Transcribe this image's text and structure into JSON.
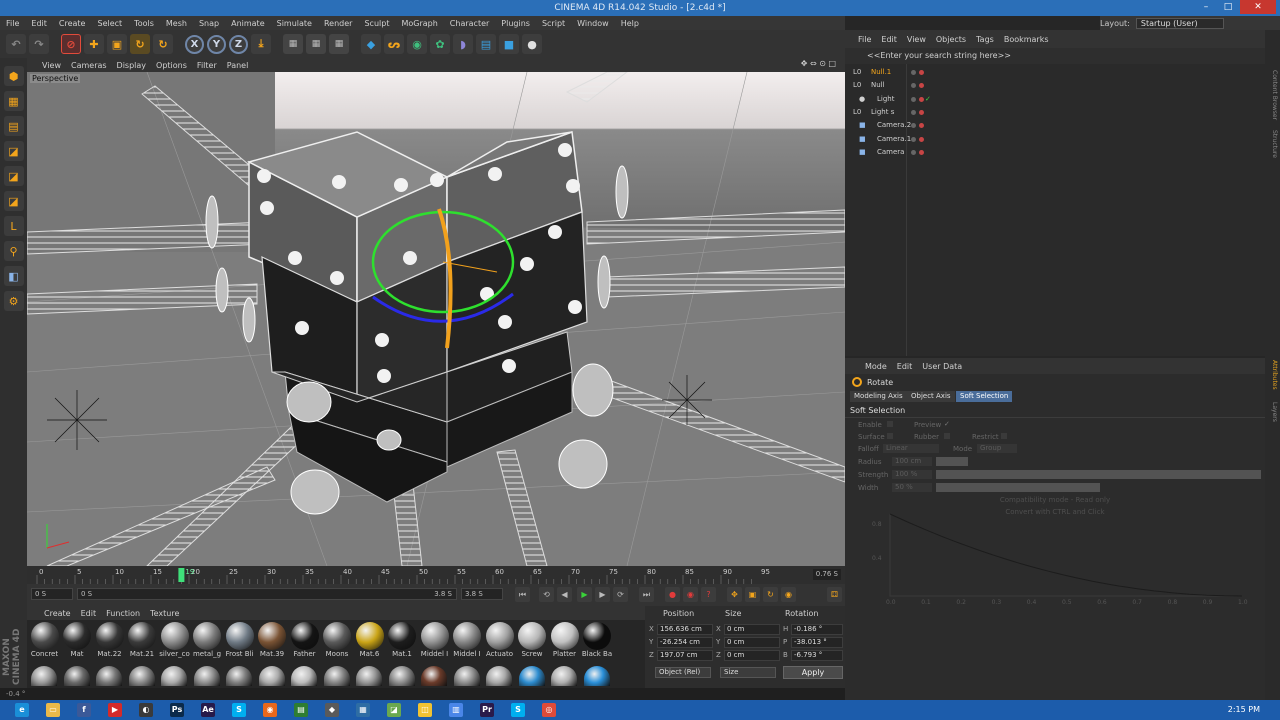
{
  "window": {
    "title": "CINEMA 4D R14.042 Studio - [2.c4d *]",
    "controls": [
      "–",
      "□",
      "✕"
    ]
  },
  "menubar": [
    "File",
    "Edit",
    "Create",
    "Select",
    "Tools",
    "Mesh",
    "Snap",
    "Animate",
    "Simulate",
    "Render",
    "Sculpt",
    "MoGraph",
    "Character",
    "Plugins",
    "Script",
    "Window",
    "Help"
  ],
  "layout": {
    "label": "Layout:",
    "value": "Startup (User)"
  },
  "toolbar": {
    "undo_icon": "↶",
    "redo_icon": "↷",
    "live_select_icon": "⊘",
    "move_icon": "✚",
    "scale_icon": "▣",
    "rotate_icon": "↻",
    "recent_icon": "↻",
    "x_label": "X",
    "y_label": "Y",
    "z_label": "Z",
    "coord_icon": "⤓",
    "render_view_icon": "▦",
    "render_pv_icon": "▦",
    "render_settings_icon": "▦",
    "cube_icon": "◆",
    "spline_icon": "ᔕ",
    "nurbs_icon": "◉",
    "array_icon": "✿",
    "deformer_icon": "◗",
    "scene_icon": "▤",
    "camera_icon": "■",
    "light_icon": "●"
  },
  "leftpalette": [
    "⬢",
    "▦",
    "▤",
    "◪",
    "◪",
    "◪",
    "L",
    "⚲",
    "◧",
    "⚙"
  ],
  "viewport": {
    "menu": [
      "View",
      "Cameras",
      "Display",
      "Options",
      "Filter",
      "Panel"
    ],
    "controls": "✥ ⇔ ⊙ □",
    "label": "Perspective"
  },
  "timeline": {
    "ticks": [
      "0",
      "5",
      "10",
      "15",
      "20",
      "25",
      "30",
      "35",
      "40",
      "45",
      "50",
      "55",
      "60",
      "65",
      "70",
      "75",
      "80",
      "85",
      "90",
      "95"
    ],
    "current_frame": "19",
    "end_display": "0.76 S"
  },
  "transport": {
    "start": "0 S",
    "range_start": "0 S",
    "range_end": "3.8 S",
    "end": "3.8 S",
    "buttons": [
      "⏮",
      "⟲",
      "◀",
      "▶",
      "▶",
      "⟳",
      "⏭"
    ],
    "key_buttons": [
      "●",
      "◉",
      "?"
    ],
    "mode_buttons": [
      "✥",
      "▣",
      "↻",
      "◉",
      "⚃"
    ]
  },
  "materials": {
    "menu": [
      "Create",
      "Edit",
      "Function",
      "Texture"
    ],
    "row1": [
      {
        "name": "Concret",
        "color": "#4a4a4a"
      },
      {
        "name": "Mat",
        "color": "#2b2b2b"
      },
      {
        "name": "Mat.22",
        "color": "#363636"
      },
      {
        "name": "Mat.21",
        "color": "#3a3a3a"
      },
      {
        "name": "silver_co",
        "color": "#8c8c8c"
      },
      {
        "name": "metal_g",
        "color": "#7a7a7a"
      },
      {
        "name": "Frost Bli",
        "color": "#6f7a85"
      },
      {
        "name": "Mat.39",
        "color": "#7a5334"
      },
      {
        "name": "Father",
        "color": "#141414"
      },
      {
        "name": "Moons",
        "color": "#5a5a5a"
      },
      {
        "name": "Mat.6",
        "color": "#caa416"
      },
      {
        "name": "Mat.1",
        "color": "#1d1d1d"
      },
      {
        "name": "Middel I",
        "color": "#929292"
      },
      {
        "name": "Middel I",
        "color": "#858585"
      },
      {
        "name": "Actuato",
        "color": "#a0a0a0"
      },
      {
        "name": "Screw",
        "color": "#b5b5b5"
      },
      {
        "name": "Platter",
        "color": "#c0c0c0"
      },
      {
        "name": "Black Ba",
        "color": "#0c0c0c"
      }
    ],
    "row2_colors": [
      "#9a9a9a",
      "#6a6a6a",
      "#777777",
      "#888888",
      "#aaaaaa",
      "#909090",
      "#7f7f7f",
      "#aaaaaa",
      "#bcbcbc",
      "#868686",
      "#979797",
      "#8c8c8c",
      "#6b3b2a",
      "#8f8f8f",
      "#a8a8a8",
      "#2d8ccf",
      "#b0b0b0",
      "#2a8fd8"
    ]
  },
  "coordinates": {
    "headers": [
      "Position",
      "Size",
      "Rotation"
    ],
    "rows": [
      {
        "axis": "X",
        "pos": "156.636 cm",
        "size_axis": "X",
        "size": "0 cm",
        "rot_axis": "H",
        "rot": "-0.186 °"
      },
      {
        "axis": "Y",
        "pos": "-26.254 cm",
        "size_axis": "Y",
        "size": "0 cm",
        "rot_axis": "P",
        "rot": "-38.013 °"
      },
      {
        "axis": "Z",
        "pos": "197.07 cm",
        "size_axis": "Z",
        "size": "0 cm",
        "rot_axis": "B",
        "rot": "-6.793 °"
      }
    ],
    "mode": "Object (Rel)",
    "size_mode": "Size",
    "apply": "Apply"
  },
  "statusline": "-0.4 °",
  "objects": {
    "menu": [
      "File",
      "Edit",
      "View",
      "Objects",
      "Tags",
      "Bookmarks"
    ],
    "search": "<<Enter your search string here>>",
    "items": [
      {
        "name": "Null.1",
        "color": "#f3a51c",
        "icon": "L0",
        "indent": 0
      },
      {
        "name": "Null",
        "color": "#cfcfcf",
        "icon": "L0",
        "indent": 0
      },
      {
        "name": "Light",
        "color": "#cfcfcf",
        "icon": "●",
        "indent": 1,
        "check": "✓"
      },
      {
        "name": "Light s",
        "color": "#cfcfcf",
        "icon": "L0",
        "indent": 0
      },
      {
        "name": "Camera.2",
        "color": "#cfcfcf",
        "icon": "■",
        "indent": 1
      },
      {
        "name": "Camera.1",
        "color": "#cfcfcf",
        "icon": "■",
        "indent": 1
      },
      {
        "name": "Camera",
        "color": "#cfcfcf",
        "icon": "■",
        "indent": 1
      }
    ]
  },
  "attributes": {
    "menu": [
      "Mode",
      "Edit",
      "User Data"
    ],
    "title": "Rotate",
    "tabs": [
      "Modeling Axis",
      "Object Axis",
      "Soft Selection"
    ],
    "section": "Soft Selection",
    "fields": {
      "enable": "Enable",
      "preview": "Preview",
      "preview_check": "✓",
      "surface": "Surface",
      "rubber": "Rubber",
      "restrict": "Restrict",
      "falloff": "Falloff",
      "falloff_val": "Linear",
      "mode": "Mode",
      "mode_val": "Group",
      "radius": "Radius",
      "radius_val": "100 cm",
      "strength": "Strength",
      "strength_val": "100 %",
      "width": "Width",
      "width_val": "50 %"
    },
    "note1": "Compatibility mode - Read only",
    "note2": "Convert with CTRL and Click",
    "graph": {
      "y_ticks": [
        "0.8",
        "0.4"
      ],
      "x_ticks": [
        "0.0",
        "0.1",
        "0.2",
        "0.3",
        "0.4",
        "0.5",
        "0.6",
        "0.7",
        "0.8",
        "0.9",
        "1.0"
      ]
    }
  },
  "side_tabs": [
    "Content Browser",
    "Structure",
    "Attributes",
    "Layers"
  ],
  "taskbar": {
    "time": "2:15 PM",
    "apps": [
      {
        "label": "e",
        "color": "#1a8fd8"
      },
      {
        "label": "▭",
        "color": "#e9b94a"
      },
      {
        "label": "f",
        "color": "#3b5998"
      },
      {
        "label": "▶",
        "color": "#d42a2a"
      },
      {
        "label": "◐",
        "color": "#3a3a3a"
      },
      {
        "label": "Ps",
        "color": "#0b2a4a"
      },
      {
        "label": "Ae",
        "color": "#271a4a"
      },
      {
        "label": "S",
        "color": "#00aff0"
      },
      {
        "label": "◉",
        "color": "#e8681c"
      },
      {
        "label": "▤",
        "color": "#2e7d32"
      },
      {
        "label": "◆",
        "color": "#5a5a5a"
      },
      {
        "label": "▦",
        "color": "#2e6da4"
      },
      {
        "label": "◪",
        "color": "#6aa84f"
      },
      {
        "label": "◫",
        "color": "#f1c232"
      },
      {
        "label": "▥",
        "color": "#4a86e8"
      },
      {
        "label": "Pr",
        "color": "#2a1a4a"
      },
      {
        "label": "S",
        "color": "#00aff0"
      },
      {
        "label": "◎",
        "color": "#dd4b39"
      }
    ]
  }
}
